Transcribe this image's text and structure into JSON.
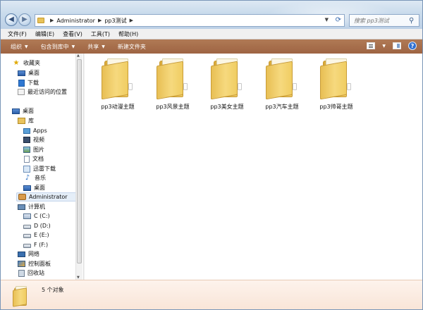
{
  "address": {
    "crumbs": [
      "Administrator",
      "pp3测试"
    ],
    "search_placeholder": "搜索 pp3测试"
  },
  "menu": [
    "文件(F)",
    "编辑(E)",
    "查看(V)",
    "工具(T)",
    "帮助(H)"
  ],
  "toolbar": {
    "organize": "组织",
    "include_library": "包含到库中",
    "share": "共享",
    "new_folder": "新建文件夹"
  },
  "sidebar": {
    "favorites": "收藏夹",
    "fav_items": [
      "桌面",
      "下载",
      "最近访问的位置"
    ],
    "desktop": "桌面",
    "library": "库",
    "lib_items": [
      "Apps",
      "视频",
      "图片",
      "文档",
      "迅雷下载",
      "音乐",
      "桌面"
    ],
    "user": "Administrator",
    "computer": "计算机",
    "drives": [
      "C (C:)",
      "D (D:)",
      "E (E:)",
      "F (F:)"
    ],
    "network": "网络",
    "control_panel": "控制面板",
    "recycle_bin": "回收站"
  },
  "folders": [
    "pp3动漫主题",
    "pp3风景主题",
    "pp3美女主题",
    "pp3汽车主题",
    "pp3帅哥主题"
  ],
  "status": {
    "count_text": "5 个对象"
  },
  "colors": {
    "command_bar": "#a56d4b",
    "details_bg": "#fbeee4",
    "folder": "#f0cc68"
  }
}
